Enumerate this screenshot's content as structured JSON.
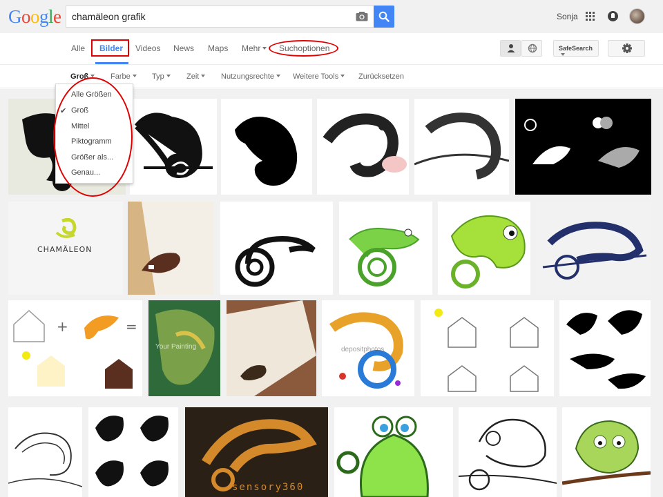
{
  "header": {
    "logo_letters": [
      "G",
      "o",
      "o",
      "g",
      "l",
      "e"
    ],
    "logo_colors": [
      "#4285f4",
      "#ea4335",
      "#fbbc05",
      "#4285f4",
      "#34a853",
      "#ea4335"
    ],
    "search_value": "chamäleon grafik",
    "user_name": "Sonja",
    "icons": {
      "camera": "camera-icon",
      "search": "magnifier-icon",
      "apps": "grid-icon",
      "notifications": "bell-icon",
      "avatar": "user-avatar"
    }
  },
  "tabs": {
    "items": [
      "Alle",
      "Bilder",
      "Videos",
      "News",
      "Maps",
      "Mehr",
      "Suchoptionen"
    ],
    "active": "Bilder"
  },
  "tools": {
    "safesearch_label": "SafeSearch",
    "icons": {
      "person": "person-icon",
      "globe": "globe-icon",
      "settings": "gear-icon"
    }
  },
  "filters": {
    "items": [
      "Groß",
      "Farbe",
      "Typ",
      "Zeit",
      "Nutzungsrechte",
      "Weitere Tools",
      "Zurücksetzen"
    ]
  },
  "size_dropdown": {
    "items": [
      "Alle Größen",
      "Groß",
      "Mittel",
      "Piktogramm",
      "Größer als...",
      "Genau..."
    ],
    "selected": "Groß"
  },
  "results": {
    "tile_texts": {
      "chamaeleon_logo": "CHAMÄLEON",
      "painting_watermark": "Your Painting",
      "deposit_watermark": "depositphotos",
      "sensory_watermark": "sensory360"
    }
  },
  "colors": {
    "accent": "#4285f4",
    "annotation": "#e00000",
    "grid_background": "#f1f1f1"
  }
}
